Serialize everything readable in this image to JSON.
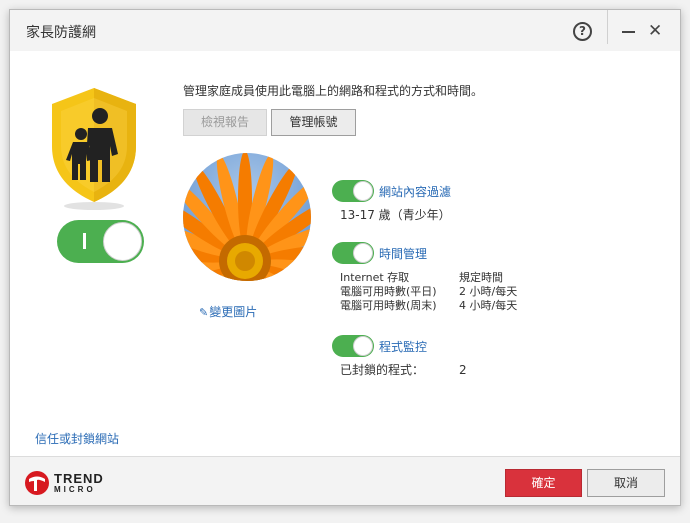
{
  "window": {
    "title": "家長防護網"
  },
  "colors": {
    "toggle_on": "#4caf50",
    "link": "#2a6bb5",
    "primary_button": "#d9323c",
    "shield": "#f5c518"
  },
  "main": {
    "description": "管理家庭成員使用此電腦上的網路和程式的方式和時間。",
    "view_report_label": "檢視報告",
    "manage_account_label": "管理帳號",
    "change_picture_label": "變更圖片",
    "trust_block_link": "信任或封鎖網站",
    "protection_enabled": true
  },
  "features": {
    "web_filter": {
      "label": "網站內容過濾",
      "enabled": true,
      "value": "13-17 歲（青少年）"
    },
    "time_management": {
      "label": "時間管理",
      "enabled": true,
      "rows": [
        {
          "name": "Internet 存取",
          "value": "規定時間"
        },
        {
          "name": "電腦可用時數(平日)",
          "value": "2 小時/每天"
        },
        {
          "name": "電腦可用時數(周末)",
          "value": "4 小時/每天"
        }
      ]
    },
    "program_control": {
      "label": "程式監控",
      "enabled": true,
      "blocked_label": "已封鎖的程式：",
      "blocked_count": "2"
    }
  },
  "footer": {
    "logo_text": "TREND",
    "logo_sub": "MICRO",
    "ok_label": "確定",
    "cancel_label": "取消"
  },
  "icons": {
    "help": "question-circle-icon",
    "minimize": "minimize-icon",
    "close": "close-icon",
    "shield": "family-shield-icon",
    "edit": "pencil-icon"
  }
}
